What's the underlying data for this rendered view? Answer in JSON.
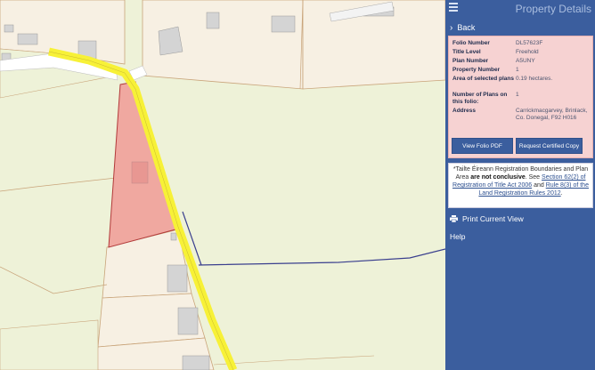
{
  "header": {
    "title": "Property Details"
  },
  "nav": {
    "back_label": "Back"
  },
  "details": [
    {
      "key": "Folio Number",
      "value": "DL57623F"
    },
    {
      "key": "Title Level",
      "value": "Freehold"
    },
    {
      "key": "Plan Number",
      "value": "A5UNY"
    },
    {
      "key": "Property Number",
      "value": "1"
    },
    {
      "key": "Area of selected plans",
      "value": "0.19 hectares."
    },
    {
      "key": "Number of Plans on this folio:",
      "value": "1"
    },
    {
      "key": "Address",
      "value": "Carrickmacgarvey, Brinlack, Co. Donegal, F92 H016"
    }
  ],
  "buttons": {
    "view_pdf": "View Folio PDF",
    "request_copy": "Request Certified Copy"
  },
  "notice": {
    "prefix": "*Tailte Éireann Registration Boundaries and Plan Area",
    "bold": "are not conclusive",
    "mid": ". See",
    "link1": "Section 62(2) of Registration of Title Act 2006",
    "and": "and",
    "link2": "Rule 8(3) of the Land Registration Rules 2012",
    "suffix": "."
  },
  "actions": {
    "print_label": "Print Current View",
    "help_label": "Help"
  },
  "colors": {
    "panel": "#3b5e9e",
    "parcel_fill": "#f0a8a0",
    "road": "#f7f137",
    "map_bg": "#eef2d8"
  }
}
